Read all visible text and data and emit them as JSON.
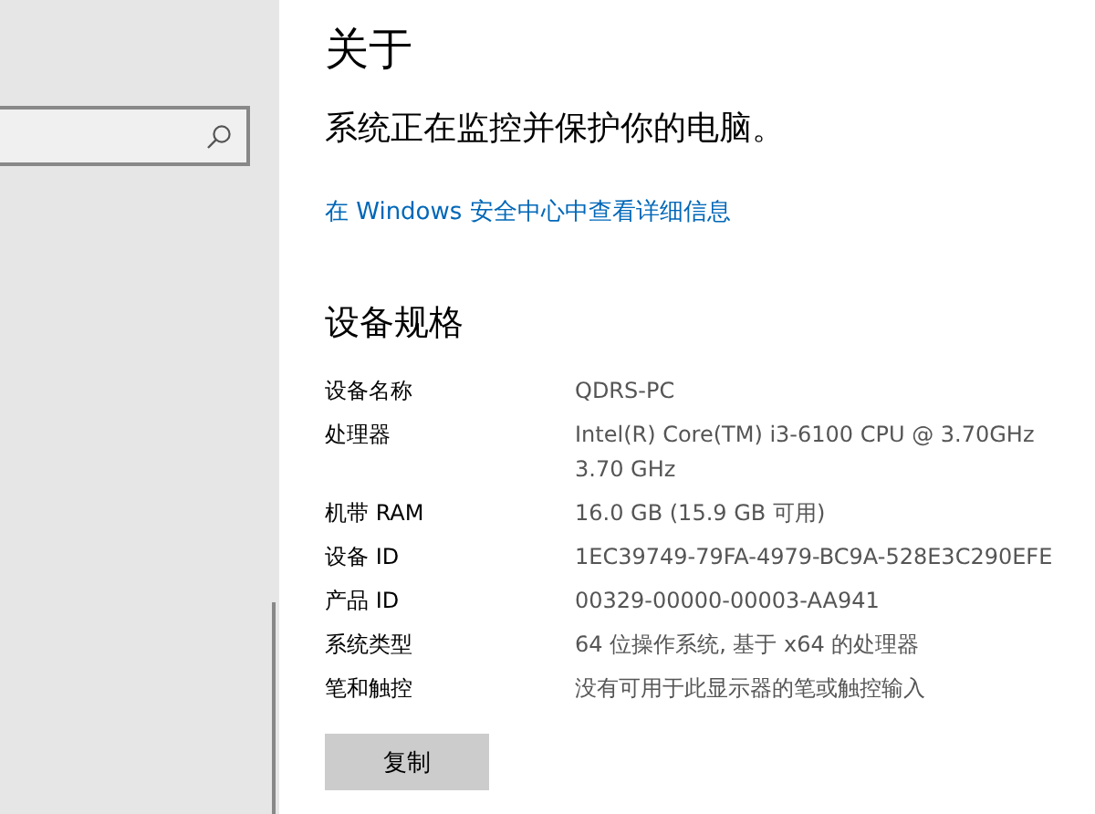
{
  "main": {
    "title": "关于",
    "status": "系统正在监控并保护你的电脑。",
    "link": "在 Windows 安全中心中查看详细信息",
    "section_title": "设备规格",
    "specs": [
      {
        "label": "设备名称",
        "value": "QDRS-PC"
      },
      {
        "label": "处理器",
        "value": "Intel(R) Core(TM) i3-6100 CPU @ 3.70GHz\n3.70 GHz"
      },
      {
        "label": "机带 RAM",
        "value": "16.0 GB (15.9 GB 可用)"
      },
      {
        "label": "设备 ID",
        "value": "1EC39749-79FA-4979-BC9A-528E3C290EFE"
      },
      {
        "label": "产品 ID",
        "value": "00329-00000-00003-AA941"
      },
      {
        "label": "系统类型",
        "value": "64 位操作系统, 基于 x64 的处理器"
      },
      {
        "label": "笔和触控",
        "value": "没有可用于此显示器的笔或触控输入"
      }
    ],
    "copy_button": "复制"
  }
}
